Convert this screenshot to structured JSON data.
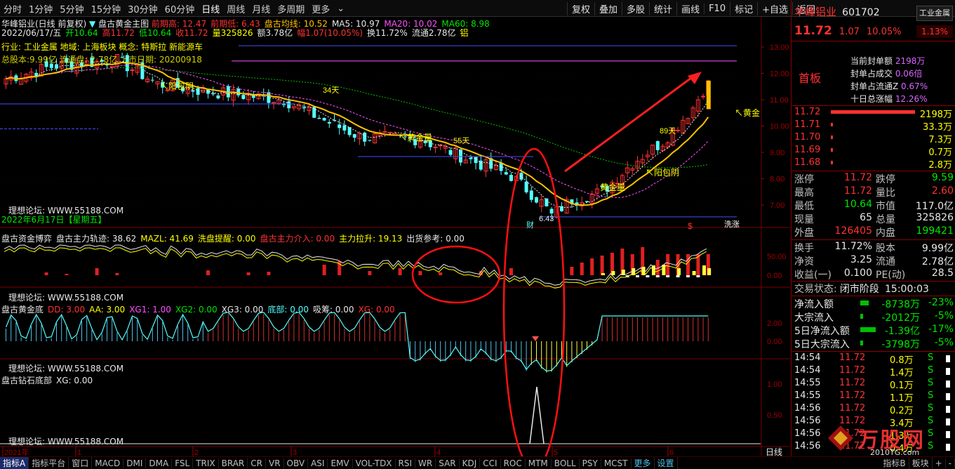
{
  "periods": {
    "items": [
      "分时",
      "1分钟",
      "5分钟",
      "15分钟",
      "30分钟",
      "60分钟",
      "日线",
      "周线",
      "月线",
      "多周期",
      "更多"
    ],
    "active_index": 6
  },
  "toolbar": [
    "复权",
    "叠加",
    "多股",
    "统计",
    "画线",
    "F10",
    "标记",
    "+自选",
    "返回"
  ],
  "chart": {
    "title_line": "华峰铝业(日线 前复权)",
    "main_indicator": "盘古黄金主图",
    "main_legend": [
      {
        "t": "前期高: 12.47",
        "c": "#ff3232"
      },
      {
        "t": "前期低: 6.43",
        "c": "#ff3232"
      },
      {
        "t": "盘古均线: 10.52",
        "c": "#ffc000"
      },
      {
        "t": "MA5: 10.97",
        "c": "#e8e8e8"
      },
      {
        "t": "MA20: 10.02",
        "c": "#ff50ff"
      },
      {
        "t": "MA60: 8.98",
        "c": "#00e600"
      }
    ],
    "info_line": [
      {
        "t": "2022/06/17/五",
        "c": "#e8e8e8"
      },
      {
        "t": "开10.64",
        "c": "#00e600"
      },
      {
        "t": "高11.72",
        "c": "#ff3232"
      },
      {
        "t": "低10.64",
        "c": "#00e600"
      },
      {
        "t": "收11.72",
        "c": "#ff3232"
      },
      {
        "t": "量325826",
        "c": "#ffff00"
      },
      {
        "t": "额3.78亿",
        "c": "#e8e8e8"
      },
      {
        "t": "幅1.07(10.05%)",
        "c": "#ff3232"
      },
      {
        "t": "换11.72%",
        "c": "#e8e8e8"
      },
      {
        "t": "流通2.78亿",
        "c": "#e8e8e8"
      },
      {
        "t": "铝",
        "c": "#ffff00"
      }
    ],
    "overlay_tags": "行业: 工业金属  地域: 上海板块  概念: 特斯拉 新能源车",
    "overlay_tags2": "总股本:9.99亿  流通盘: 2.78亿  上市日期: 20200918",
    "forum": "理想论坛: WWW.55188.COM",
    "date_label": "2022年6月17日【星期五】",
    "price_axis": [
      "13.00",
      "12.00",
      "11.00",
      "10.00",
      "9.00",
      "8.00",
      "7.00"
    ],
    "labels": {
      "yang1": "↖阳包阴",
      "yang2": "↖阳包阴",
      "gold1": "↖黄金量",
      "gold2": "黄金量",
      "gold3": "↖黄金",
      "d34": "34天",
      "d55": "55天",
      "d89": "89天",
      "low": "6.43",
      "cai": "财",
      "xi": "洗涨",
      "dollar": "$"
    },
    "sub1": {
      "legend": [
        {
          "t": "盘古资金博弈",
          "c": "#e8e8e8"
        },
        {
          "t": "盘古主力轨迹: 38.62",
          "c": "#e8e8e8"
        },
        {
          "t": "MAZL: 41.69",
          "c": "#ffff00"
        },
        {
          "t": "洗盘提醒: 0.00",
          "c": "#ffff00"
        },
        {
          "t": "盘古主力介入: 0.00",
          "c": "#ff3232"
        },
        {
          "t": "主力拉升: 19.13",
          "c": "#ffff00"
        },
        {
          "t": "出货参考: 0.00",
          "c": "#e8e8e8"
        }
      ],
      "axis": [
        "50.00",
        "0.00"
      ]
    },
    "sub2": {
      "legend": [
        {
          "t": "盘古黄金底",
          "c": "#e8e8e8"
        },
        {
          "t": "DD: 3.00",
          "c": "#ff3232"
        },
        {
          "t": "AA: 3.00",
          "c": "#ffff00"
        },
        {
          "t": "XG1: 1.00",
          "c": "#ff50ff"
        },
        {
          "t": "XG2: 0.00",
          "c": "#00e600"
        },
        {
          "t": "XG3: 0.00",
          "c": "#e8e8e8"
        },
        {
          "t": "底部: 0.00",
          "c": "#54ffff"
        },
        {
          "t": "吸筹: 0.00",
          "c": "#e8e8e8"
        },
        {
          "t": "XG: 0.00",
          "c": "#ff3232"
        }
      ],
      "axis": [
        "2.00",
        "0.00"
      ]
    },
    "sub3": {
      "legend": [
        {
          "t": "盘古钻石底部",
          "c": "#e8e8e8"
        },
        {
          "t": "XG: 0.00",
          "c": "#e8e8e8"
        }
      ],
      "axis": [
        "1.00",
        "0.50"
      ]
    },
    "time_axis": [
      "2021年",
      "1",
      "2",
      "3",
      "4",
      "5",
      "6"
    ]
  },
  "stock": {
    "name": "华峰铝业",
    "code": "601702",
    "sector": "工业金属",
    "sector_pct": "1.13%",
    "price": "11.72",
    "change": "1.07",
    "pct": "10.05%",
    "board": "首板",
    "board_info": [
      {
        "k": "当前封单额",
        "v": "2198万"
      },
      {
        "k": "封单占成交",
        "v": "0.06倍"
      },
      {
        "k": "封单占流通Z",
        "v": "0.67%"
      },
      {
        "k": "十日总涨幅",
        "v": "12.26%"
      }
    ],
    "orderbook": [
      {
        "p": "11.72",
        "v": "2198万",
        "bar": 100
      },
      {
        "p": "11.71",
        "v": "33.3万",
        "bar": 2
      },
      {
        "p": "11.70",
        "v": "7.3万",
        "bar": 1
      },
      {
        "p": "11.69",
        "v": "0.7万",
        "bar": 1
      },
      {
        "p": "11.68",
        "v": "2.8万",
        "bar": 1
      }
    ],
    "quote": [
      {
        "k1": "涨停",
        "v1": "11.72",
        "c1": "#ff3232",
        "k2": "跌停",
        "v2": "9.59",
        "c2": "#00e600"
      },
      {
        "k1": "最高",
        "v1": "11.72",
        "c1": "#ff3232",
        "k2": "量比",
        "v2": "2.60",
        "c2": "#ff3232"
      },
      {
        "k1": "最低",
        "v1": "10.64",
        "c1": "#00e600",
        "k2": "市值",
        "v2": "117.0亿",
        "c2": "#e8e8e8"
      },
      {
        "k1": "现量",
        "v1": "65",
        "c1": "#e8e8e8",
        "k2": "总量",
        "v2": "325826",
        "c2": "#e8e8e8"
      },
      {
        "k1": "外盘",
        "v1": "126405",
        "c1": "#ff3232",
        "k2": "内盘",
        "v2": "199421",
        "c2": "#00e600"
      }
    ],
    "stats": [
      {
        "k1": "换手",
        "v1": "11.72%",
        "k2": "股本",
        "v2": "9.99亿"
      },
      {
        "k1": "净资",
        "v1": "3.25",
        "k2": "流通",
        "v2": "2.78亿"
      },
      {
        "k1": "收益(一)",
        "v1": "0.100",
        "k2": "PE(动)",
        "v2": "28.5"
      }
    ],
    "trade_status_label": "交易状态:",
    "trade_status": "闭市阶段",
    "trade_time": "15:00:03",
    "flows": [
      {
        "k": "净流入额",
        "v": "-8738万",
        "p": "-23%",
        "bar": 12
      },
      {
        "k": "大宗流入",
        "v": "-2012万",
        "p": "-5%",
        "bar": 4
      },
      {
        "k": "5日净流入额",
        "v": "-1.39亿",
        "p": "-17%",
        "bar": 22
      },
      {
        "k": "5日大宗流入",
        "v": "-3798万",
        "p": "-5%",
        "bar": 4
      }
    ],
    "ticks": [
      {
        "t": "14:54",
        "p": "11.72",
        "v": "0.8万",
        "s": "S"
      },
      {
        "t": "14:54",
        "p": "11.72",
        "v": "1.4万",
        "s": "S"
      },
      {
        "t": "14:55",
        "p": "11.72",
        "v": "0.1万",
        "s": "S"
      },
      {
        "t": "14:55",
        "p": "11.72",
        "v": "1.1万",
        "s": "S"
      },
      {
        "t": "14:56",
        "p": "11.72",
        "v": "0.2万",
        "s": "S"
      },
      {
        "t": "14:56",
        "p": "11.72",
        "v": "3.4万",
        "s": "S"
      },
      {
        "t": "14:56",
        "p": "11.72",
        "v": "1.3万",
        "s": "S"
      },
      {
        "t": "14:56",
        "p": "11.72",
        "v": "0.4万",
        "s": "S"
      }
    ],
    "watermark": "万股网",
    "watermark_url": "2010TG.com"
  },
  "bottom_tabs": {
    "left": [
      "指标A",
      "指标平台",
      "窗口",
      "MACD",
      "DMI",
      "DMA",
      "FSL",
      "TRIX",
      "BRAR",
      "CR",
      "VR",
      "OBV",
      "ASI",
      "EMV",
      "VOL-TDX",
      "RSI",
      "WR",
      "SAR",
      "KDJ",
      "CCI",
      "ROC",
      "MTM",
      "BOLL",
      "PSY",
      "MCST",
      "更多",
      "设置"
    ],
    "right": [
      "指标B",
      "板块",
      "+",
      "-"
    ],
    "period_label": "日线"
  }
}
